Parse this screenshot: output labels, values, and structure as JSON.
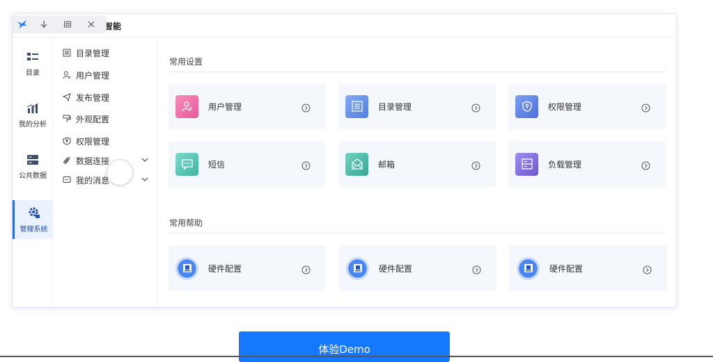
{
  "titlebar": {
    "app_title": "智能"
  },
  "icon_nav": [
    {
      "label": "目录",
      "icon": "directory-icon"
    },
    {
      "label": "我的分析",
      "icon": "bar-chart-icon"
    },
    {
      "label": "公共数据",
      "icon": "database-icon"
    },
    {
      "label": "管理系统",
      "icon": "gear-settings-icon",
      "active": true
    }
  ],
  "submenu": [
    {
      "label": "目录管理",
      "icon": "list-icon"
    },
    {
      "label": "用户管理",
      "icon": "user-icon"
    },
    {
      "label": "发布管理",
      "icon": "send-icon"
    },
    {
      "label": "外观配置",
      "icon": "paint-roller-icon"
    },
    {
      "label": "权限管理",
      "icon": "shield-key-icon"
    },
    {
      "label": "数据连接",
      "icon": "paperclip-icon",
      "expandable": true
    },
    {
      "label": "我的消息",
      "icon": "message-icon",
      "expandable": true
    }
  ],
  "sections": {
    "common_settings": {
      "title": "常用设置",
      "cards": [
        {
          "label": "用户管理",
          "icon": "user-card-icon",
          "color": "#ee6fa4"
        },
        {
          "label": "目录管理",
          "icon": "list-card-icon",
          "color": "#5f8fe8"
        },
        {
          "label": "权限管理",
          "icon": "shield-card-icon",
          "color": "#5a7fe2"
        },
        {
          "label": "短信",
          "icon": "sms-icon",
          "color": "#4cc3b3"
        },
        {
          "label": "邮箱",
          "icon": "mail-icon",
          "color": "#45b8a8"
        },
        {
          "label": "负载管理",
          "icon": "server-icon",
          "color": "#7b69d6"
        }
      ]
    },
    "common_help": {
      "title": "常用帮助",
      "cards": [
        {
          "label": "硬件配置",
          "icon": "hardware-icon",
          "color": "#2f6ee0"
        },
        {
          "label": "硬件配置",
          "icon": "hardware-icon",
          "color": "#2f6ee0"
        },
        {
          "label": "硬件配置",
          "icon": "hardware-icon",
          "color": "#2f6ee0"
        }
      ]
    }
  },
  "cta": {
    "label": "体验Demo",
    "color": "#1677ff"
  }
}
